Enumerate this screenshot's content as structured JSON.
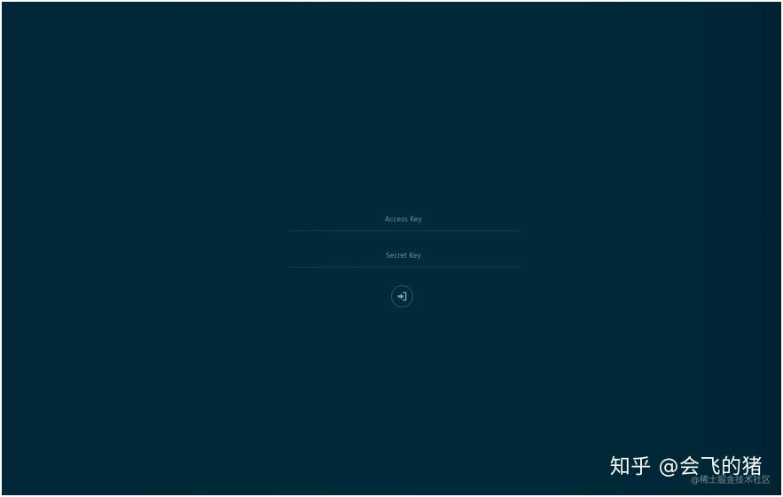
{
  "login": {
    "access_key_placeholder": "Access Key",
    "secret_key_placeholder": "Secret Key",
    "access_key_value": "",
    "secret_key_value": "",
    "submit_icon": "sign-in-icon"
  },
  "watermark": {
    "main": "知乎 @会飞的猪",
    "sub": "@稀土掘金技术社区"
  },
  "colors": {
    "background": "#002a39",
    "field_underline": "#0d3b4a",
    "placeholder": "#6f8d97",
    "button_border": "#2a5564",
    "button_icon": "#7fa0ab"
  }
}
